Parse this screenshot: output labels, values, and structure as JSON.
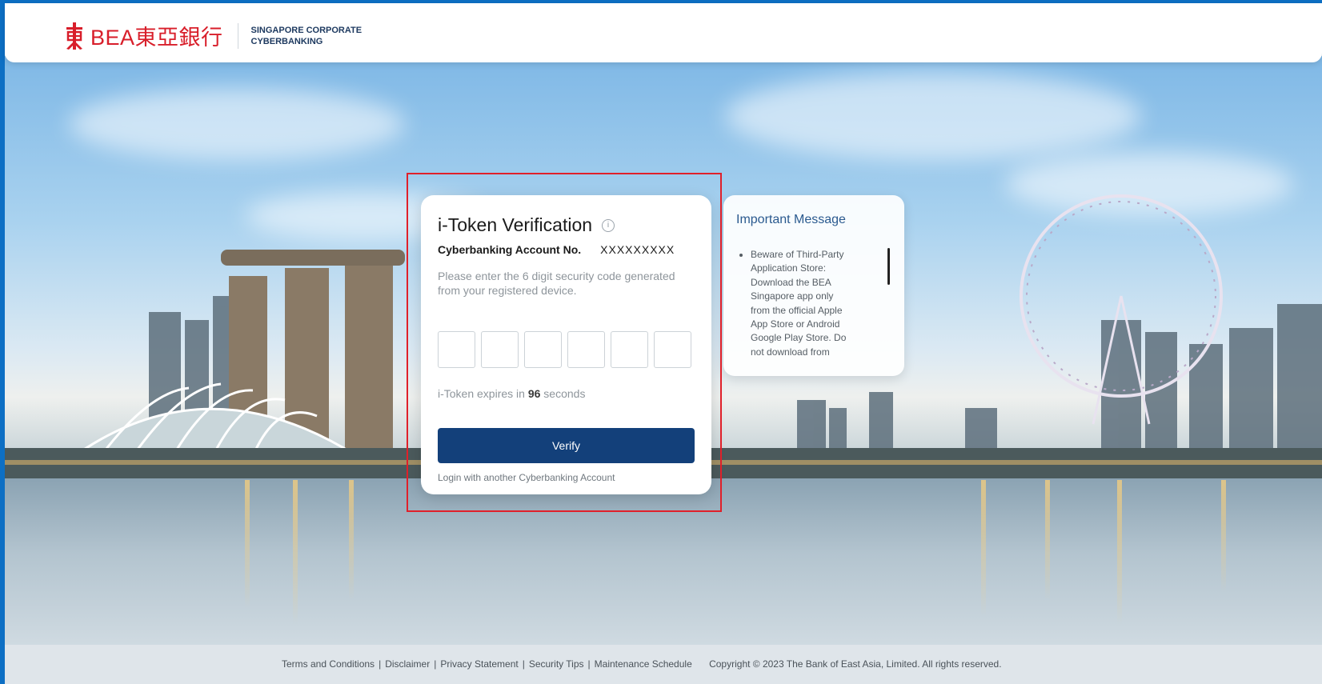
{
  "header": {
    "logo_text": "BEA東亞銀行",
    "subtitle_line1": "SINGAPORE CORPORATE",
    "subtitle_line2": "CYBERBANKING"
  },
  "card": {
    "title": "i-Token Verification",
    "info_icon": "info-icon",
    "account_label": "Cyberbanking Account No.",
    "account_value": "XXXXXXXXX",
    "instruction": "Please enter the 6 digit security code generated from your registered device.",
    "otp_digits": [
      "",
      "",
      "",
      "",
      "",
      ""
    ],
    "expiry_prefix": "i-Token expires in",
    "expiry_seconds": "96",
    "expiry_suffix": "seconds",
    "verify_label": "Verify",
    "alt_login_label": "Login with another Cyberbanking Account"
  },
  "message": {
    "title": "Important Message",
    "items": [
      "Beware of Third-Party Application Store: Download the BEA Singapore app only from the official Apple App Store or Android Google Play Store. Do not download from"
    ]
  },
  "footer": {
    "links": [
      "Terms and Conditions",
      "Disclaimer",
      "Privacy Statement",
      "Security Tips",
      "Maintenance Schedule"
    ],
    "separator": "|",
    "copyright": "Copyright © 2023 The Bank of East Asia, Limited. All rights reserved."
  },
  "colors": {
    "brand_red": "#d81e2a",
    "primary_button": "#13407a",
    "message_title": "#2b5a8f",
    "highlight_border": "#e0202a"
  }
}
